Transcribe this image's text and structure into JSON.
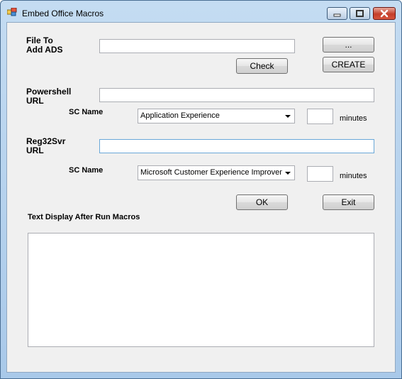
{
  "window": {
    "title": "Embed Office Macros",
    "icon": "app-window-icon",
    "caption_buttons": [
      "minimize-icon",
      "maximize-icon",
      "close-icon"
    ]
  },
  "file_section": {
    "label_line1": "File To",
    "label_line2": "Add ADS",
    "file_value": "",
    "browse_label": "...",
    "check_label": "Check",
    "create_label": "CREATE"
  },
  "powershell": {
    "label_line1": "Powershell",
    "label_line2": "URL",
    "url_value": "",
    "sc_label": "SC Name",
    "sc_selected": "Application Experience",
    "minutes_value": "",
    "minutes_label": "minutes"
  },
  "reg32": {
    "label_line1": "Reg32Svr",
    "label_line2": "URL",
    "url_value": "",
    "sc_label": "SC Name",
    "sc_selected": "Microsoft Customer Experience Improveme",
    "minutes_value": "",
    "minutes_label": "minutes"
  },
  "actions": {
    "ok_label": "OK",
    "exit_label": "Exit"
  },
  "output": {
    "label": "Text Display After Run Macros",
    "text": ""
  }
}
